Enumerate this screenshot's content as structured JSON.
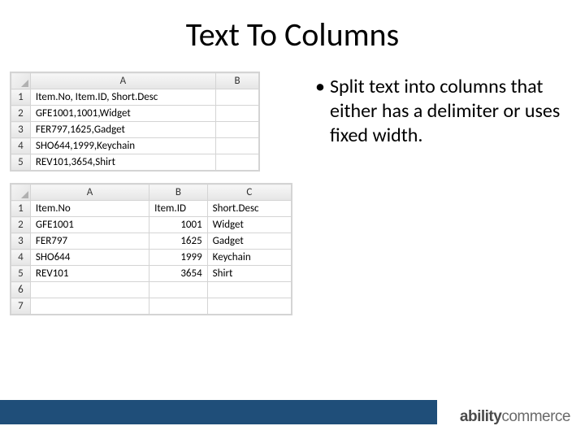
{
  "slide": {
    "title": "Text To Columns",
    "bullet": "Split text into columns that either has a delimiter or uses fixed width."
  },
  "sheet1": {
    "col_headers": [
      "A",
      "B"
    ],
    "rows": [
      {
        "num": "1",
        "A": "Item.No, Item.ID, Short.Desc",
        "B": ""
      },
      {
        "num": "2",
        "A": "GFE1001,1001,Widget",
        "B": ""
      },
      {
        "num": "3",
        "A": "FER797,1625,Gadget",
        "B": ""
      },
      {
        "num": "4",
        "A": "SHO644,1999,Keychain",
        "B": ""
      },
      {
        "num": "5",
        "A": "REV101,3654,Shirt",
        "B": ""
      }
    ]
  },
  "sheet2": {
    "col_headers": [
      "A",
      "B",
      "C"
    ],
    "rows": [
      {
        "num": "1",
        "A": "Item.No",
        "B": "Item.ID",
        "C": "Short.Desc"
      },
      {
        "num": "2",
        "A": "GFE1001",
        "B": "1001",
        "C": "Widget"
      },
      {
        "num": "3",
        "A": "FER797",
        "B": "1625",
        "C": "Gadget"
      },
      {
        "num": "4",
        "A": "SHO644",
        "B": "1999",
        "C": "Keychain"
      },
      {
        "num": "5",
        "A": "REV101",
        "B": "3654",
        "C": "Shirt"
      },
      {
        "num": "6",
        "A": "",
        "B": "",
        "C": ""
      },
      {
        "num": "7",
        "A": "",
        "B": "",
        "C": ""
      }
    ]
  },
  "footer": {
    "logo_bold": "ability",
    "logo_light": "commerce"
  }
}
